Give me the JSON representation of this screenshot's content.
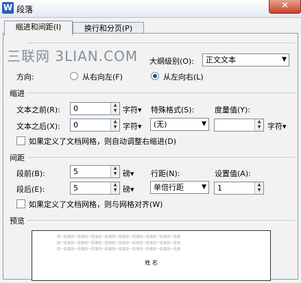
{
  "window": {
    "title": "段落",
    "app_icon": "W",
    "close": "✕"
  },
  "tabs": [
    {
      "label": "缩进和间距(I)"
    },
    {
      "label": "换行和分页(P)"
    }
  ],
  "watermark": "三联网 3LIAN.COM",
  "general": {
    "outline_label": "大纲级别(O):",
    "outline_value": "正文文本",
    "direction_label": "方向:",
    "rtl_label": "从右向左(F)",
    "ltr_label": "从左向右(L)"
  },
  "indent": {
    "section": "缩进",
    "before_label": "文本之前(R):",
    "before_value": "0",
    "before_unit": "字符▾",
    "after_label": "文本之后(X):",
    "after_value": "0",
    "after_unit": "字符▾",
    "special_label": "特殊格式(S):",
    "special_value": "(无)",
    "measure_label": "度量值(Y):",
    "measure_value": "",
    "measure_unit": "字符▾",
    "grid_check_label": "如果定义了文档网格，则自动调整右缩进(D)"
  },
  "spacing": {
    "section": "间距",
    "before_label": "段前(B):",
    "before_value": "5",
    "before_unit": "磅▾",
    "after_label": "段后(E):",
    "after_value": "5",
    "after_unit": "磅▾",
    "line_label": "行距(N):",
    "line_value": "单倍行距",
    "setting_label": "设置值(A):",
    "setting_value": "1",
    "grid_check_label": "如果定义了文档网格，则与网格对齐(W)"
  },
  "preview": {
    "section": "预览",
    "sample_lines": [
      "前一段落前一段落前一段落前一段落前一段落前一段落前一段落前一段落前一段落",
      "前一段落前一段落前一段落前一段落前一段落前一段落前一段落前一段落前一段落",
      "前一段落前一段落前一段落前一段落前一段落前一段落前一段落前一段落前一段落"
    ],
    "current_text": "姓 名"
  }
}
